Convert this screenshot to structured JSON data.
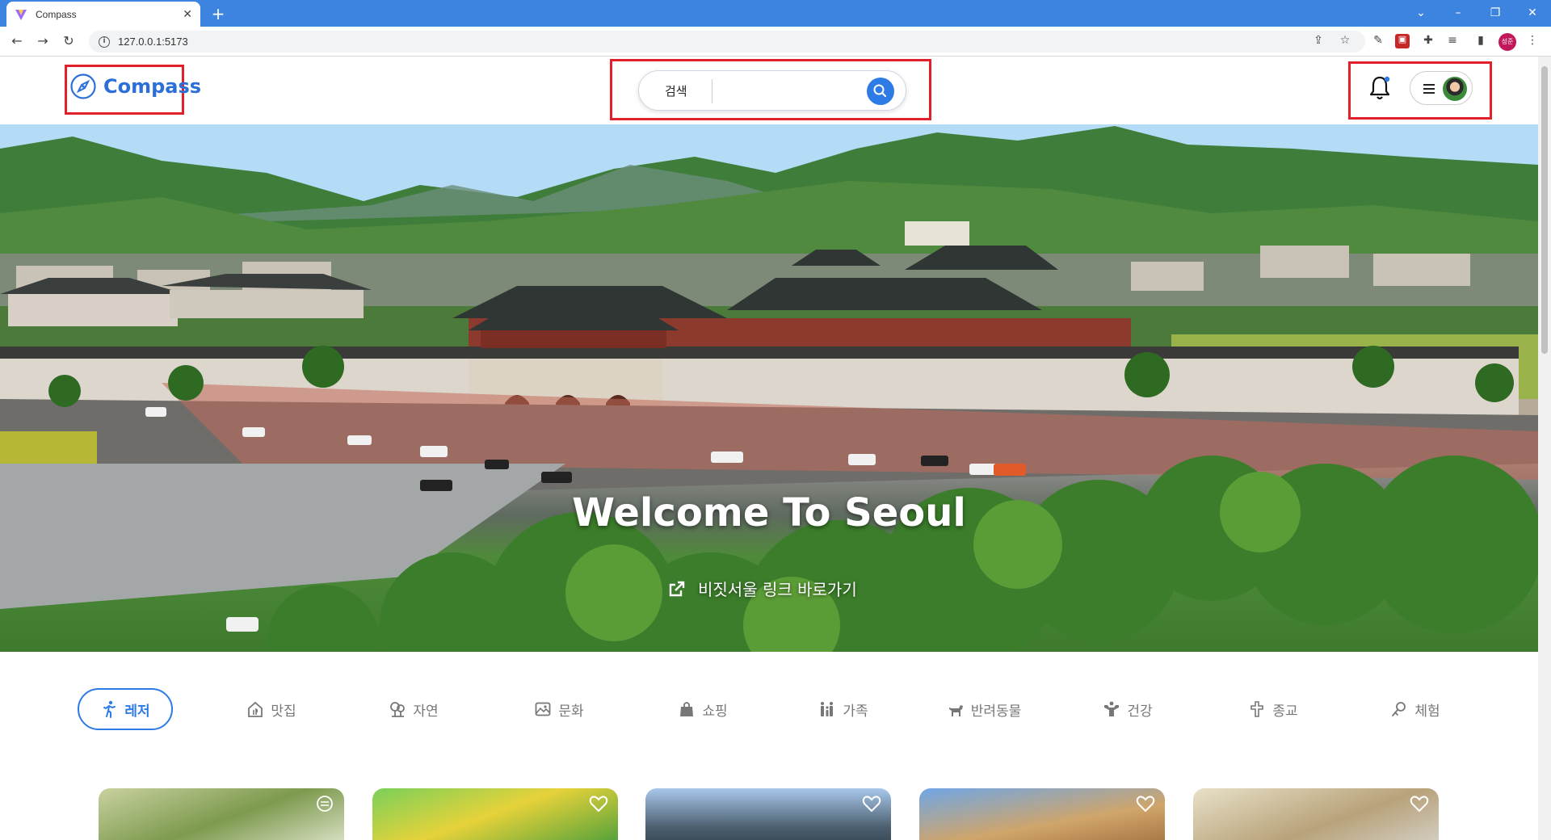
{
  "browser": {
    "tab_title": "Compass",
    "url": "127.0.0.1:5173",
    "profile_initials": "성준"
  },
  "header": {
    "logo_text": "Compass",
    "search_label": "검색",
    "search_value": ""
  },
  "hero": {
    "title": "Welcome To Seoul",
    "link_text": "비짓서울 링크 바로가기"
  },
  "categories": [
    {
      "label": "레저",
      "icon": "runner-icon",
      "active": true
    },
    {
      "label": "맛집",
      "icon": "restaurant-icon",
      "active": false
    },
    {
      "label": "자연",
      "icon": "tree-icon",
      "active": false
    },
    {
      "label": "문화",
      "icon": "gallery-icon",
      "active": false
    },
    {
      "label": "쇼핑",
      "icon": "shopping-bag-icon",
      "active": false
    },
    {
      "label": "가족",
      "icon": "family-icon",
      "active": false
    },
    {
      "label": "반려동물",
      "icon": "dog-icon",
      "active": false
    },
    {
      "label": "건강",
      "icon": "fitness-icon",
      "active": false
    },
    {
      "label": "종교",
      "icon": "cross-icon",
      "active": false
    },
    {
      "label": "체험",
      "icon": "experience-icon",
      "active": false
    }
  ],
  "colors": {
    "accent": "#2d7be5",
    "highlight_box": "#e2202a",
    "tabbar": "#3c84e0"
  }
}
